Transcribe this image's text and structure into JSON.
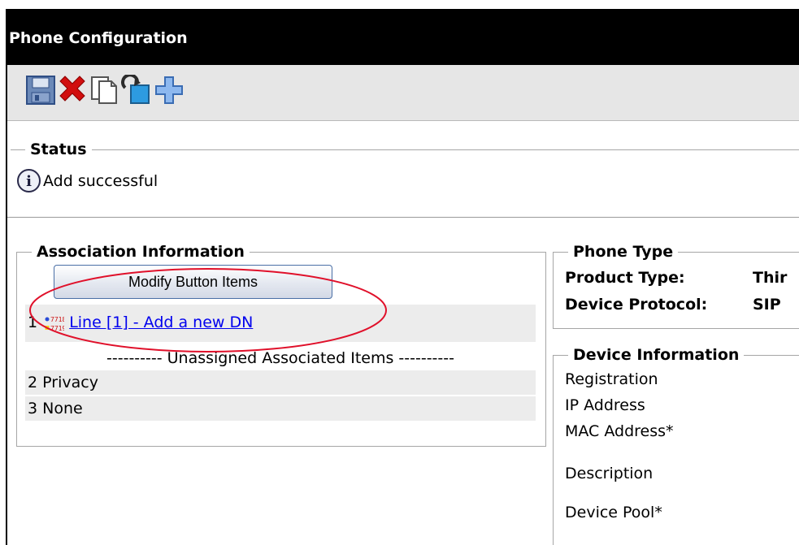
{
  "window": {
    "title": "Phone Configuration"
  },
  "toolbar": {
    "buttons": [
      {
        "icon": "save-icon"
      },
      {
        "icon": "delete-icon"
      },
      {
        "icon": "copy-icon"
      },
      {
        "icon": "reset-icon"
      },
      {
        "icon": "add-new-icon"
      }
    ]
  },
  "status": {
    "legend": "Status",
    "info_glyph": "i",
    "message": "Add successful"
  },
  "association": {
    "legend": "Association Information",
    "modify_button": "Modify Button Items",
    "line_number": "1",
    "line_icon_top": "7718",
    "line_icon_bottom": "7719",
    "line_link": "Line [1] - Add a new DN",
    "unassigned_header": "---------- Unassigned Associated Items ----------",
    "items": [
      {
        "number": "2",
        "label": "Privacy"
      },
      {
        "number": "3",
        "label": "None"
      }
    ]
  },
  "phone_type": {
    "legend": "Phone Type",
    "product_type_label": "Product Type:",
    "product_type_value": "Thir",
    "device_protocol_label": "Device Protocol:",
    "device_protocol_value": "SIP"
  },
  "device_info": {
    "legend": "Device Information",
    "registration": "Registration",
    "ip_address": "IP Address",
    "mac_address": "MAC Address",
    "description": "Description",
    "device_pool": "Device Pool",
    "required_marker": "*"
  },
  "colors": {
    "titlebar_bg": "#000000",
    "link": "#0000ee",
    "highlight_ellipse": "#e0102a"
  }
}
